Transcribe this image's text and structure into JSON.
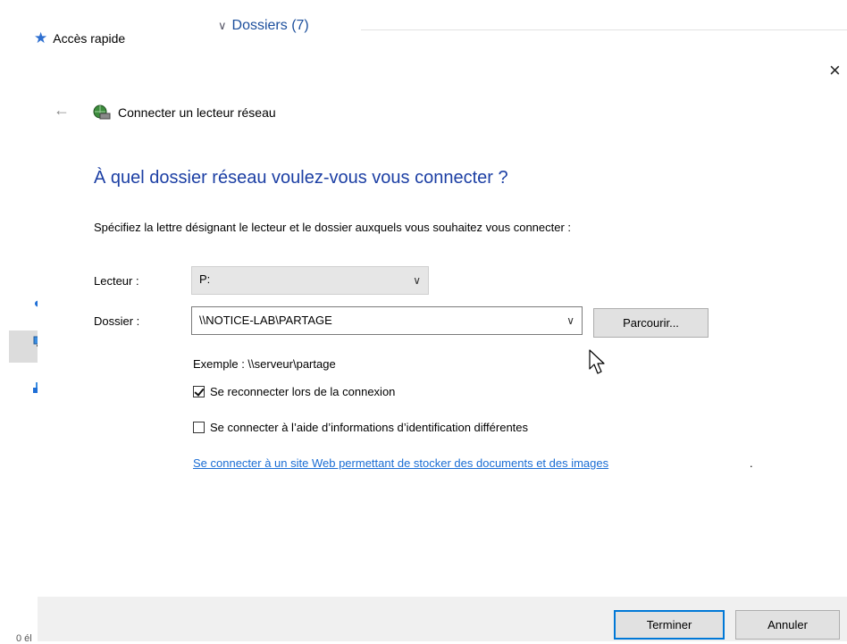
{
  "background": {
    "quick_access_label": "Accès rapide",
    "folders_section_label": "Dossiers (7)",
    "status_fragment": "0 él"
  },
  "dialog": {
    "close_glyph": "×",
    "back_glyph": "←",
    "window_title": "Connecter un lecteur réseau",
    "heading": "À quel dossier réseau voulez-vous vous connecter ?",
    "description": "Spécifiez la lettre désignant le lecteur et le dossier auxquels vous souhaitez vous connecter :",
    "drive_label": "Lecteur :",
    "drive_value": "P:",
    "folder_label": "Dossier :",
    "folder_value": "\\\\NOTICE-LAB\\PARTAGE",
    "browse_label": "Parcourir...",
    "example_text": "Exemple : \\\\serveur\\partage",
    "reconnect_label": "Se reconnecter lors de la connexion",
    "reconnect_checked": true,
    "other_credentials_label": "Se connecter à l’aide d’informations d’identification différentes",
    "other_credentials_checked": false,
    "website_link": "Se connecter à un site Web permettant de stocker des documents et des images",
    "website_link_suffix": ".",
    "finish_label": "Terminer",
    "cancel_label": "Annuler"
  },
  "colors": {
    "heading_blue": "#1c3fa4",
    "link_blue": "#1a6dd4",
    "focus_blue": "#0078d7"
  }
}
